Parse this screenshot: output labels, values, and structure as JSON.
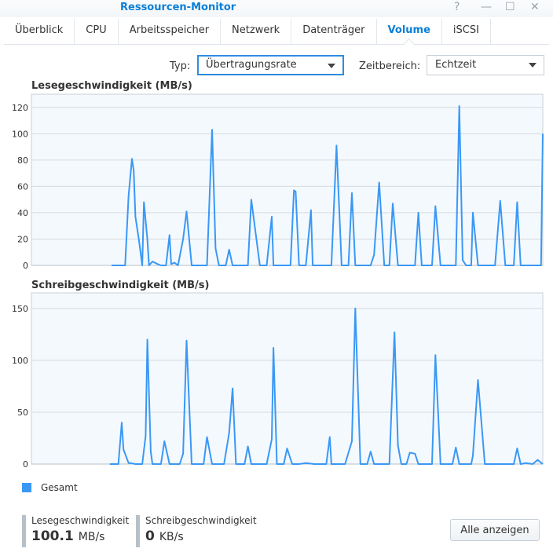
{
  "window": {
    "title": "Ressourcen-Monitor",
    "buttons": [
      "?",
      "—",
      "☐",
      "✕"
    ]
  },
  "tabs": [
    {
      "label": "Überblick",
      "active": false
    },
    {
      "label": "CPU",
      "active": false
    },
    {
      "label": "Arbeitsspeicher",
      "active": false
    },
    {
      "label": "Netzwerk",
      "active": false
    },
    {
      "label": "Datenträger",
      "active": false
    },
    {
      "label": "Volume",
      "active": true
    },
    {
      "label": "iSCSI",
      "active": false
    }
  ],
  "filters": {
    "type_label": "Typ:",
    "type_value": "Übertragungsrate",
    "range_label": "Zeitbereich:",
    "range_value": "Echtzeit"
  },
  "colors": {
    "series": "#3a98f5",
    "accent": "#0a7fd8",
    "plot_bg": "#f4f9fe"
  },
  "chart_data": [
    {
      "type": "line",
      "title": "Lesegeschwindigkeit (MB/s)",
      "ylim": [
        0,
        130
      ],
      "yticks": [
        0,
        20,
        40,
        60,
        80,
        100,
        120
      ],
      "grid": true,
      "xlim": [
        0,
        300
      ],
      "series": [
        {
          "name": "Gesamt",
          "points": [
            [
              47,
              0
            ],
            [
              55,
              0
            ],
            [
              57,
              53
            ],
            [
              59,
              81
            ],
            [
              60,
              72
            ],
            [
              61,
              37
            ],
            [
              63,
              20
            ],
            [
              65,
              0
            ],
            [
              66,
              48
            ],
            [
              68,
              20
            ],
            [
              69,
              0
            ],
            [
              71,
              3
            ],
            [
              74,
              1
            ],
            [
              76,
              0
            ],
            [
              79,
              0
            ],
            [
              81,
              23
            ],
            [
              82,
              1
            ],
            [
              84,
              2
            ],
            [
              86,
              0
            ],
            [
              89,
              20
            ],
            [
              91,
              41
            ],
            [
              94,
              0
            ],
            [
              103,
              0
            ],
            [
              106,
              103
            ],
            [
              108,
              13
            ],
            [
              110,
              0
            ],
            [
              114,
              0
            ],
            [
              116,
              12
            ],
            [
              118,
              0
            ],
            [
              127,
              0
            ],
            [
              129,
              50
            ],
            [
              134,
              0
            ],
            [
              138,
              0
            ],
            [
              141,
              37
            ],
            [
              142,
              0
            ],
            [
              152,
              0
            ],
            [
              154,
              57
            ],
            [
              155,
              56
            ],
            [
              157,
              0
            ],
            [
              161,
              0
            ],
            [
              164,
              42
            ],
            [
              165,
              0
            ],
            [
              176,
              0
            ],
            [
              179,
              91
            ],
            [
              182,
              0
            ],
            [
              186,
              0
            ],
            [
              188,
              55
            ],
            [
              190,
              0
            ],
            [
              199,
              0
            ],
            [
              201,
              8
            ],
            [
              204,
              63
            ],
            [
              207,
              0
            ],
            [
              210,
              0
            ],
            [
              212,
              47
            ],
            [
              215,
              0
            ],
            [
              225,
              0
            ],
            [
              227,
              40
            ],
            [
              229,
              0
            ],
            [
              235,
              0
            ],
            [
              237,
              45
            ],
            [
              240,
              0
            ],
            [
              249,
              0
            ],
            [
              251,
              121
            ],
            [
              253,
              4
            ],
            [
              255,
              0
            ],
            [
              258,
              0
            ],
            [
              259,
              40
            ],
            [
              262,
              0
            ],
            [
              272,
              0
            ],
            [
              275,
              49
            ],
            [
              278,
              0
            ],
            [
              283,
              0
            ],
            [
              285,
              48
            ],
            [
              287,
              0
            ],
            [
              299,
              0
            ],
            [
              300,
              100
            ]
          ]
        }
      ]
    },
    {
      "type": "line",
      "title": "Schreibgeschwindigkeit (MB/s)",
      "ylim": [
        0,
        165
      ],
      "yticks": [
        0,
        50,
        100,
        150
      ],
      "grid": true,
      "xlim": [
        0,
        300
      ],
      "series": [
        {
          "name": "Gesamt",
          "points": [
            [
              46,
              0
            ],
            [
              51,
              0
            ],
            [
              53,
              40
            ],
            [
              54,
              14
            ],
            [
              57,
              1
            ],
            [
              58,
              1
            ],
            [
              61,
              0
            ],
            [
              65,
              0
            ],
            [
              67,
              27
            ],
            [
              68,
              120
            ],
            [
              70,
              12
            ],
            [
              71,
              0
            ],
            [
              76,
              0
            ],
            [
              78,
              22
            ],
            [
              81,
              0
            ],
            [
              87,
              0
            ],
            [
              89,
              10
            ],
            [
              91,
              119
            ],
            [
              94,
              0
            ],
            [
              101,
              0
            ],
            [
              103,
              26
            ],
            [
              106,
              0
            ],
            [
              113,
              0
            ],
            [
              116,
              30
            ],
            [
              118,
              73
            ],
            [
              120,
              0
            ],
            [
              125,
              0
            ],
            [
              127,
              17
            ],
            [
              129,
              0
            ],
            [
              138,
              0
            ],
            [
              141,
              24
            ],
            [
              142,
              112
            ],
            [
              144,
              0
            ],
            [
              148,
              0
            ],
            [
              150,
              15
            ],
            [
              153,
              0
            ],
            [
              157,
              0
            ],
            [
              161,
              1
            ],
            [
              166,
              0
            ],
            [
              173,
              0
            ],
            [
              175,
              26
            ],
            [
              176,
              0
            ],
            [
              184,
              0
            ],
            [
              188,
              22
            ],
            [
              190,
              150
            ],
            [
              193,
              0
            ],
            [
              197,
              0
            ],
            [
              199,
              12
            ],
            [
              201,
              0
            ],
            [
              210,
              0
            ],
            [
              213,
              127
            ],
            [
              215,
              18
            ],
            [
              217,
              0
            ],
            [
              220,
              0
            ],
            [
              222,
              11
            ],
            [
              225,
              10
            ],
            [
              227,
              0
            ],
            [
              235,
              0
            ],
            [
              237,
              105
            ],
            [
              240,
              0
            ],
            [
              247,
              0
            ],
            [
              249,
              16
            ],
            [
              251,
              0
            ],
            [
              258,
              0
            ],
            [
              259,
              8
            ],
            [
              262,
              81
            ],
            [
              266,
              0
            ],
            [
              283,
              0
            ],
            [
              285,
              15
            ],
            [
              287,
              0
            ],
            [
              290,
              1
            ],
            [
              294,
              0
            ],
            [
              297,
              4
            ],
            [
              300,
              0
            ]
          ]
        }
      ]
    }
  ],
  "legend": {
    "label": "Gesamt"
  },
  "stats": [
    {
      "label": "Lesegeschwindigkeit",
      "value": "100.1",
      "unit": "MB/s"
    },
    {
      "label": "Schreibgeschwindigkeit",
      "value": "0",
      "unit": "KB/s"
    }
  ],
  "show_all_button": "Alle anzeigen"
}
